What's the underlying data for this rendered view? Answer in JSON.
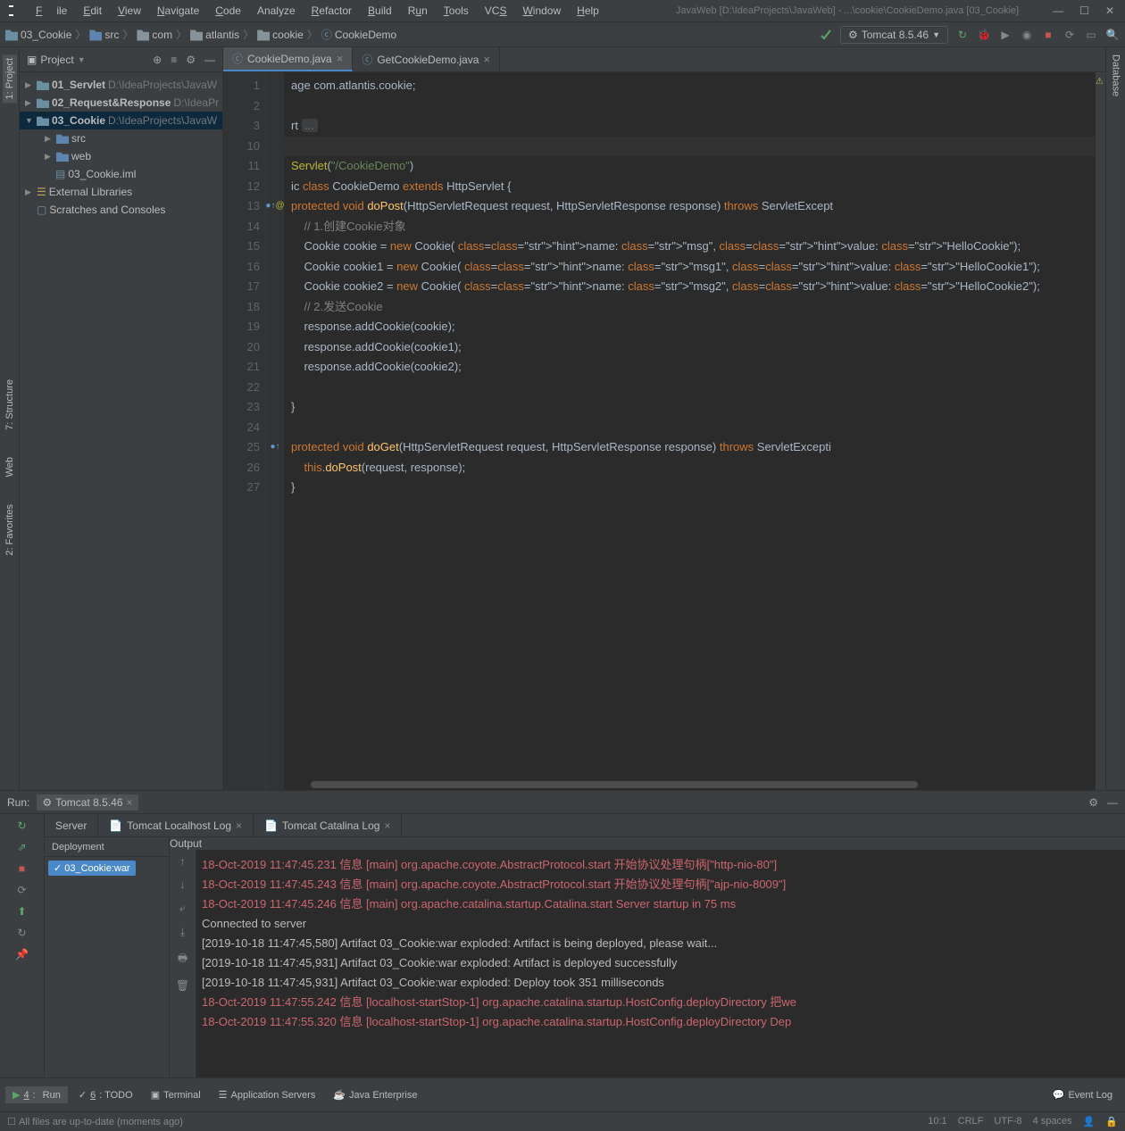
{
  "title": "JavaWeb [D:\\IdeaProjects\\JavaWeb] - ...\\cookie\\CookieDemo.java [03_Cookie]",
  "menu": {
    "file": "File",
    "edit": "Edit",
    "view": "View",
    "navigate": "Navigate",
    "code": "Code",
    "analyze": "Analyze",
    "refactor": "Refactor",
    "build": "Build",
    "run": "Run",
    "tools": "Tools",
    "vcs": "VCS",
    "window": "Window",
    "help": "Help"
  },
  "breadcrumbs": [
    "03_Cookie",
    "src",
    "com",
    "atlantis",
    "cookie",
    "CookieDemo"
  ],
  "runconfig": "Tomcat 8.5.46",
  "leftstrip": {
    "project": "1: Project",
    "structure": "7: Structure",
    "web": "Web",
    "favorites": "2: Favorites"
  },
  "rightstrip": {
    "database": "Database"
  },
  "sidebar": {
    "title": "Project",
    "tree": [
      {
        "name": "01_Servlet",
        "path": "D:\\IdeaProjects\\JavaW",
        "depth": 0
      },
      {
        "name": "02_Request&Response",
        "path": "D:\\IdeaPr",
        "depth": 0
      },
      {
        "name": "03_Cookie",
        "path": "D:\\IdeaProjects\\JavaW",
        "depth": 0,
        "expanded": true,
        "bold": true
      },
      {
        "name": "src",
        "depth": 1,
        "folder": true
      },
      {
        "name": "web",
        "depth": 1,
        "folder": true
      },
      {
        "name": "03_Cookie.iml",
        "depth": 1,
        "file": true
      },
      {
        "name": "External Libraries",
        "depth": -1,
        "lib": true
      },
      {
        "name": "Scratches and Consoles",
        "depth": -1,
        "scratch": true
      }
    ]
  },
  "tabs": [
    {
      "label": "CookieDemo.java",
      "active": true
    },
    {
      "label": "GetCookieDemo.java",
      "active": false
    }
  ],
  "code": {
    "startLine": 1,
    "lines": [
      "age com.atlantis.cookie;",
      "",
      "rt ...",
      "",
      "Servlet(\"/CookieDemo\")",
      "ic class CookieDemo extends HttpServlet {",
      "protected void doPost(HttpServletRequest request, HttpServletResponse response) throws ServletExcept",
      "    // 1.创建Cookie对象",
      "    Cookie cookie = new Cookie( name: \"msg\", value: \"HelloCookie\");",
      "    Cookie cookie1 = new Cookie( name: \"msg1\", value: \"HelloCookie1\");",
      "    Cookie cookie2 = new Cookie( name: \"msg2\", value: \"HelloCookie2\");",
      "    // 2.发送Cookie",
      "    response.addCookie(cookie);",
      "    response.addCookie(cookie1);",
      "    response.addCookie(cookie2);",
      "",
      "}",
      "",
      "protected void doGet(HttpServletRequest request, HttpServletResponse response) throws ServletExcepti",
      "    this.doPost(request, response);",
      "}"
    ],
    "displayNumbers": [
      1,
      2,
      3,
      10,
      11,
      12,
      13,
      14,
      15,
      16,
      17,
      18,
      19,
      20,
      21,
      22,
      23,
      24,
      25,
      26,
      27
    ]
  },
  "run": {
    "label": "Run:",
    "config": "Tomcat 8.5.46",
    "tabs": {
      "server": "Server",
      "localhost": "Tomcat Localhost Log",
      "catalina": "Tomcat Catalina Log"
    },
    "dep_header": "Deployment",
    "out_header": "Output",
    "artifact": "03_Cookie:war",
    "log": [
      {
        "c": "red",
        "t": "18-Oct-2019 11:47:45.231 信息 [main] org.apache.coyote.AbstractProtocol.start 开始协议处理句柄[\"http-nio-80\"]"
      },
      {
        "c": "red",
        "t": "18-Oct-2019 11:47:45.243 信息 [main] org.apache.coyote.AbstractProtocol.start 开始协议处理句柄[\"ajp-nio-8009\"]"
      },
      {
        "c": "red",
        "t": "18-Oct-2019 11:47:45.246 信息 [main] org.apache.catalina.startup.Catalina.start Server startup in 75 ms"
      },
      {
        "c": "grey",
        "t": "Connected to server"
      },
      {
        "c": "grey",
        "t": "[2019-10-18 11:47:45,580] Artifact 03_Cookie:war exploded: Artifact is being deployed, please wait..."
      },
      {
        "c": "grey",
        "t": "[2019-10-18 11:47:45,931] Artifact 03_Cookie:war exploded: Artifact is deployed successfully"
      },
      {
        "c": "grey",
        "t": "[2019-10-18 11:47:45,931] Artifact 03_Cookie:war exploded: Deploy took 351 milliseconds"
      },
      {
        "c": "red",
        "t": "18-Oct-2019 11:47:55.242 信息 [localhost-startStop-1] org.apache.catalina.startup.HostConfig.deployDirectory 把we"
      },
      {
        "c": "red",
        "t": "18-Oct-2019 11:47:55.320 信息 [localhost-startStop-1] org.apache.catalina.startup.HostConfig.deployDirectory Dep"
      }
    ]
  },
  "bottomtabs": {
    "run": "4: Run",
    "todo": "6: TODO",
    "terminal": "Terminal",
    "appservers": "Application Servers",
    "javaee": "Java Enterprise",
    "eventlog": "Event Log"
  },
  "status": {
    "msg": "All files are up-to-date (moments ago)",
    "pos": "10:1",
    "eol": "CRLF",
    "enc": "UTF-8",
    "indent": "4 spaces"
  }
}
